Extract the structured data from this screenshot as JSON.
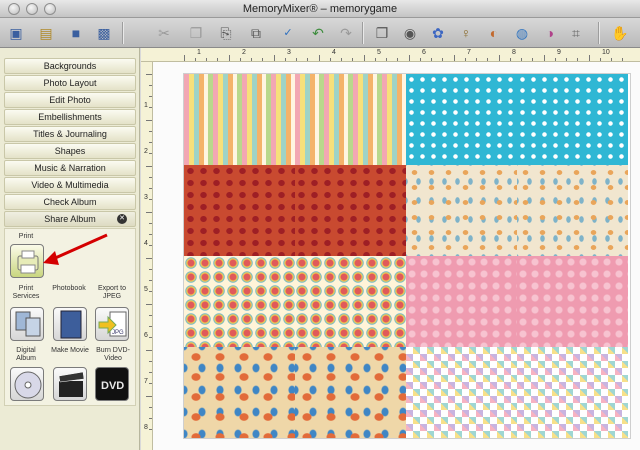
{
  "window": {
    "title": "MemoryMixer® – memorygame"
  },
  "toolbar": {
    "buttons": [
      {
        "icon": "new-page-icon",
        "glyph": "▣"
      },
      {
        "icon": "open-folder-icon",
        "glyph": "▤"
      },
      {
        "icon": "save-icon",
        "glyph": "■"
      },
      {
        "icon": "save-as-icon",
        "glyph": "▩"
      },
      {
        "icon": "scissors-icon",
        "glyph": "✂"
      },
      {
        "icon": "copy-icon",
        "glyph": "❐"
      },
      {
        "icon": "paste-icon",
        "glyph": "⎘"
      },
      {
        "icon": "duplicate-icon",
        "glyph": "⧉"
      },
      {
        "icon": "spellcheck-icon",
        "glyph": "✓"
      },
      {
        "icon": "undo-icon",
        "glyph": "↶"
      },
      {
        "icon": "redo-icon",
        "glyph": "↷"
      },
      {
        "icon": "page-settings-icon",
        "glyph": "❐"
      },
      {
        "icon": "camera-icon",
        "glyph": "◉"
      },
      {
        "icon": "flower-icon",
        "glyph": "✿"
      },
      {
        "icon": "stamp-icon",
        "glyph": "♀"
      },
      {
        "icon": "palette-icon",
        "glyph": "◐"
      },
      {
        "icon": "globe-icon",
        "glyph": "◍"
      },
      {
        "icon": "color-wheel-icon",
        "glyph": "◑"
      },
      {
        "icon": "tag-icon",
        "glyph": "⌗"
      },
      {
        "icon": "hand-icon",
        "glyph": "✋"
      }
    ]
  },
  "sidebar": {
    "items": [
      {
        "label": "Backgrounds"
      },
      {
        "label": "Photo Layout"
      },
      {
        "label": "Edit Photo"
      },
      {
        "label": "Embellishments"
      },
      {
        "label": "Titles & Journaling"
      },
      {
        "label": "Shapes"
      },
      {
        "label": "Music & Narration"
      },
      {
        "label": "Video & Multimedia"
      },
      {
        "label": "Check Album"
      },
      {
        "label": "Share Album"
      }
    ],
    "share_panel": {
      "print_label": "Print",
      "print_services_label": "Print Services",
      "photobook_label": "Photobook",
      "export_jpeg_label": "Export to JPEG",
      "digital_album_label": "Digital Album",
      "make_movie_label": "Make Movie",
      "burn_dvd_label": "Burn DVD-Video",
      "jpg_text": "JPG",
      "dvd_text": "DVD"
    }
  },
  "ruler": {
    "top_numbers": [
      "1",
      "2",
      "3",
      "4",
      "5",
      "6",
      "7",
      "8",
      "9",
      "10"
    ],
    "left_numbers": [
      "1",
      "2",
      "3",
      "4",
      "5",
      "6",
      "7",
      "8"
    ]
  },
  "colors": {
    "annotation_arrow": "#d40000",
    "sidebar_bg": "#ecebd5",
    "ruler_bg": "#f5f2d6"
  }
}
